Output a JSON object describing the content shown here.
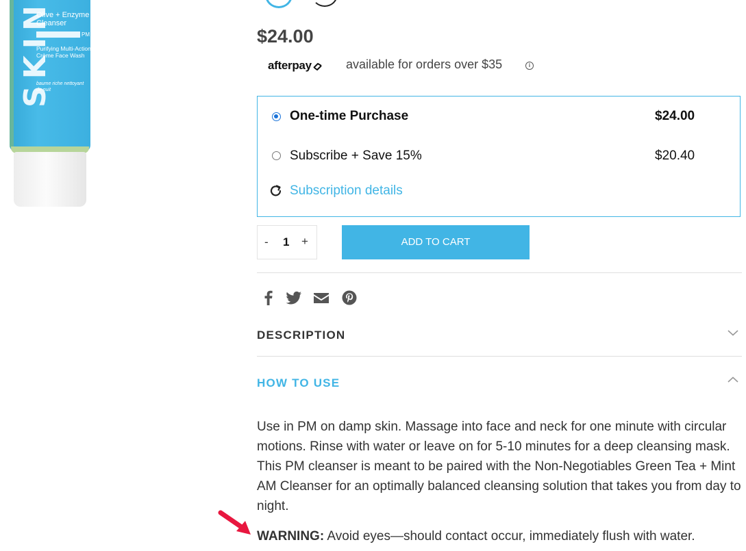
{
  "product_image": {
    "brand": "SKIN",
    "name": "Olive + Enzyme Cleanser",
    "badge": "PM",
    "description": "Purifying Multi-Action Crème Face Wash",
    "french": "baume riche nettoyant de nuit"
  },
  "price": "$24.00",
  "afterpay": {
    "logo": "afterpay",
    "text": "available for orders over $35",
    "info_icon": "info-icon"
  },
  "purchase_options": {
    "one_time": {
      "label": "One-time Purchase",
      "price": "$24.00",
      "selected": true
    },
    "subscribe": {
      "label": "Subscribe + Save 15%",
      "price": "$20.40",
      "selected": false
    },
    "details_link": "Subscription details",
    "details_icon": "refresh-icon"
  },
  "quantity": {
    "minus": "-",
    "value": "1",
    "plus": "+"
  },
  "add_to_cart": "ADD TO CART",
  "share_icons": [
    "facebook-icon",
    "twitter-icon",
    "email-icon",
    "pinterest-icon"
  ],
  "accordion": {
    "description": {
      "title": "DESCRIPTION",
      "expanded": false
    },
    "how_to_use": {
      "title": "HOW TO USE",
      "expanded": true,
      "text": "Use in PM on damp skin. Massage into face and neck for one minute with circular motions. Rinse with water or leave on for 5-10 minutes for a deep cleansing mask. This PM cleanser is meant to be paired with the Non-Negotiables Green Tea + Mint AM Cleanser for an optimally balanced cleansing solution that takes you from day to night.",
      "warning_label": "WARNING:",
      "warning_text": " Avoid eyes—should contact occur, immediately flush with water."
    }
  },
  "colors": {
    "accent": "#41b5e5",
    "radio_selected": "#1a73d9",
    "annotation_arrow": "#e8173f"
  }
}
